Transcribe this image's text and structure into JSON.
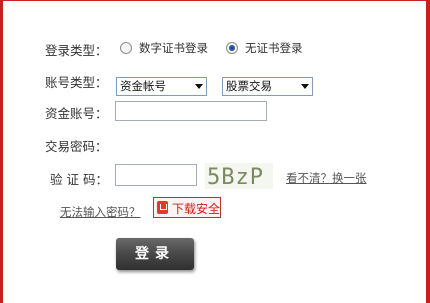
{
  "login_type": {
    "label": "登录类型：",
    "options": [
      {
        "label": "数字证书登录",
        "selected": false
      },
      {
        "label": "无证书登录",
        "selected": true
      }
    ]
  },
  "account_type": {
    "label": "账号类型：",
    "select1_value": "资金帐号",
    "select2_value": "股票交易"
  },
  "fund_account": {
    "label": "资金账号：",
    "value": ""
  },
  "trade_password": {
    "label": "交易密码："
  },
  "captcha": {
    "label": "验 证 码：",
    "value": "",
    "image_text": "5BzP",
    "refresh_link": "看不清？换一张"
  },
  "cannot_input_link": "无法输入密码？",
  "download_button": {
    "label": "下载安全",
    "icon": "shield-download-icon"
  },
  "login_button": "登录",
  "colors": {
    "frame": "#c8201c",
    "button": "#4b4b4b"
  }
}
